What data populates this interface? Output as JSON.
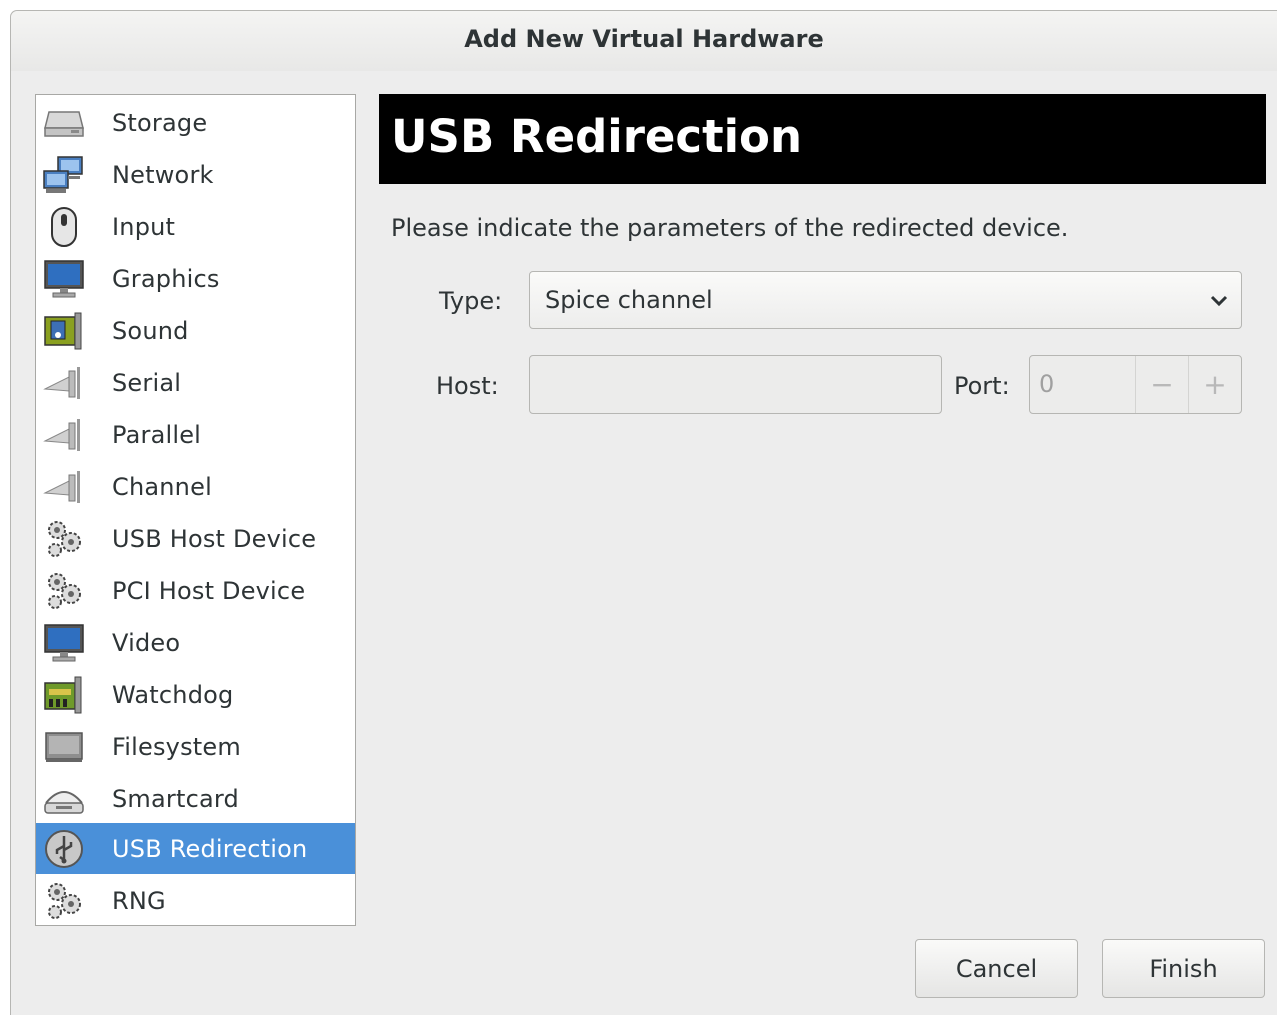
{
  "window": {
    "title": "Add New Virtual Hardware"
  },
  "sidebar": {
    "items": [
      {
        "label": "Storage",
        "icon": "storage-icon"
      },
      {
        "label": "Network",
        "icon": "network-icon"
      },
      {
        "label": "Input",
        "icon": "mouse-icon"
      },
      {
        "label": "Graphics",
        "icon": "monitor-icon"
      },
      {
        "label": "Sound",
        "icon": "sound-card-icon"
      },
      {
        "label": "Serial",
        "icon": "plug-icon"
      },
      {
        "label": "Parallel",
        "icon": "plug-icon"
      },
      {
        "label": "Channel",
        "icon": "plug-icon"
      },
      {
        "label": "USB Host Device",
        "icon": "gears-icon"
      },
      {
        "label": "PCI Host Device",
        "icon": "gears-icon"
      },
      {
        "label": "Video",
        "icon": "monitor-icon"
      },
      {
        "label": "Watchdog",
        "icon": "circuit-board-icon"
      },
      {
        "label": "Filesystem",
        "icon": "filesystem-icon"
      },
      {
        "label": "Smartcard",
        "icon": "smartcard-reader-icon"
      },
      {
        "label": "USB Redirection",
        "icon": "usb-icon"
      },
      {
        "label": "RNG",
        "icon": "gears-icon"
      }
    ],
    "selected": "USB Redirection"
  },
  "main": {
    "header": "USB Redirection",
    "description": "Please indicate the parameters of the redirected device.",
    "type_label": "Type:",
    "type_value": "Spice channel",
    "host_label": "Host:",
    "host_value": "",
    "port_label": "Port:",
    "port_value": "0",
    "spin_minus": "−",
    "spin_plus": "+"
  },
  "buttons": {
    "cancel": "Cancel",
    "finish": "Finish"
  },
  "colors": {
    "selection": "#4a90d9",
    "header_bg": "#000000"
  }
}
